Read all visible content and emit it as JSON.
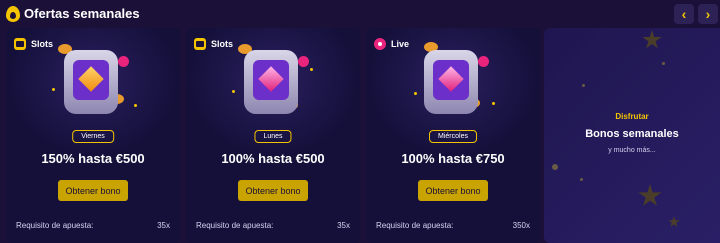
{
  "header": {
    "title": "Ofertas semanales",
    "prev_label": "‹",
    "next_label": "›"
  },
  "colors": {
    "accent": "#f5c400",
    "button": "#c9a300",
    "background": "#1a1038",
    "card": "#14103a",
    "live": "#e8247c"
  },
  "cards": [
    {
      "category": "Slots",
      "category_icon": "slot-machine-icon",
      "day": "Viernes",
      "offer": "150% hasta €500",
      "button_label": "Obtener bono",
      "requirement_label": "Requisito de apuesta:",
      "requirement_value": "35x",
      "gem": "orange-gem-icon"
    },
    {
      "category": "Slots",
      "category_icon": "slot-machine-icon",
      "day": "Lunes",
      "offer": "100% hasta €500",
      "button_label": "Obtener bono",
      "requirement_label": "Requisito de apuesta:",
      "requirement_value": "35x",
      "gem": "pink-gem-icon"
    },
    {
      "category": "Live",
      "category_icon": "live-icon",
      "day": "Miércoles",
      "offer": "100% hasta €750",
      "button_label": "Obtener bono",
      "requirement_label": "Requisito de apuesta:",
      "requirement_value": "350x",
      "gem": "pink-gem-icon"
    }
  ],
  "promo": {
    "tag": "Disfrutar",
    "title": "Bonos semanales",
    "subtitle": "y mucho más..."
  }
}
